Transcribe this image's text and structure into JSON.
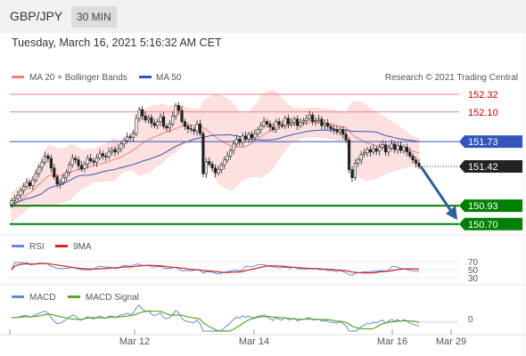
{
  "header": {
    "pair": "GBP/JPY",
    "timeframe": "30 MIN"
  },
  "timestamp": "Tuesday, March 16, 2021 5:16:32 AM CET",
  "legend": {
    "ma20": "MA 20 + Bollinger Bands",
    "ma50": "MA 50",
    "credit": "Research © 2021 Trading Central"
  },
  "rsi_legend": {
    "rsi": "RSI",
    "ma9": "9MA"
  },
  "macd_legend": {
    "macd": "MACD",
    "signal": "MACD Signal"
  },
  "colors": {
    "resistance": "#f08080",
    "resistance_text": "#cc0000",
    "support": "#008000",
    "ma50": "#3355bb",
    "bands": "#fde0e0",
    "arrow": "#2e6196",
    "rsi": "#6688dd",
    "rsi_ma": "#dd2222",
    "macd": "#6688dd",
    "macd_signal": "#55aa22"
  },
  "chart_data": {
    "type": "candlestick",
    "ylim": [
      150.62,
      152.42
    ],
    "x_ticks": [
      "Mar 12",
      "Mar 14",
      "Mar 16",
      "Mar 29"
    ],
    "levels": [
      {
        "value": 152.32,
        "label": "152.32",
        "kind": "resistance"
      },
      {
        "value": 152.1,
        "label": "152.10",
        "kind": "resistance"
      },
      {
        "value": 151.73,
        "label": "151.73",
        "kind": "pivot"
      },
      {
        "value": 151.42,
        "label": "151.42",
        "kind": "last"
      },
      {
        "value": 150.93,
        "label": "150.93",
        "kind": "support"
      },
      {
        "value": 150.7,
        "label": "150.70",
        "kind": "support"
      }
    ],
    "close": [
      150.99,
      151.02,
      151.06,
      151.12,
      151.17,
      151.22,
      151.18,
      151.25,
      151.33,
      151.41,
      151.47,
      151.55,
      151.52,
      151.4,
      151.29,
      151.2,
      151.22,
      151.28,
      151.35,
      151.44,
      151.52,
      151.5,
      151.43,
      151.39,
      151.45,
      151.52,
      151.49,
      151.47,
      151.53,
      151.58,
      151.55,
      151.54,
      151.6,
      151.63,
      151.6,
      151.64,
      151.7,
      151.74,
      151.79,
      151.78,
      151.83,
      152.02,
      152.13,
      152.05,
      152.0,
      152.03,
      151.96,
      151.93,
      151.98,
      152.04,
      151.92,
      151.9,
      151.95,
      152.05,
      152.18,
      152.12,
      151.98,
      151.92,
      151.89,
      151.88,
      151.86,
      151.95,
      151.83,
      151.33,
      151.48,
      151.45,
      151.4,
      151.34,
      151.38,
      151.44,
      151.5,
      151.55,
      151.62,
      151.7,
      151.76,
      151.72,
      151.8,
      151.76,
      151.82,
      151.78,
      151.83,
      151.88,
      151.93,
      151.98,
      151.95,
      151.91,
      151.88,
      151.98,
      151.94,
      151.93,
      152.02,
      151.95,
      151.97,
      152.01,
      151.93,
      151.97,
      151.99,
      152.02,
      152.06,
      151.98,
      151.99,
      152.01,
      151.93,
      151.96,
      151.92,
      151.89,
      151.88,
      151.85,
      151.88,
      151.82,
      151.75,
      151.38,
      151.28,
      151.46,
      151.5,
      151.57,
      151.59,
      151.63,
      151.6,
      151.64,
      151.61,
      151.66,
      151.69,
      151.6,
      151.65,
      151.7,
      151.63,
      151.68,
      151.62,
      151.66,
      151.6,
      151.55,
      151.5,
      151.46,
      151.42
    ],
    "ma20": [
      150.9,
      150.94,
      150.97,
      151.0,
      151.03,
      151.07,
      151.09,
      151.12,
      151.16,
      151.2,
      151.23,
      151.27,
      151.3,
      151.31,
      151.31,
      151.3,
      151.3,
      151.31,
      151.32,
      151.34,
      151.36,
      151.37,
      151.38,
      151.38,
      151.39,
      151.41,
      151.42,
      151.43,
      151.44,
      151.45,
      151.46,
      151.47,
      151.48,
      151.5,
      151.51,
      151.52,
      151.54,
      151.56,
      151.58,
      151.6,
      151.62,
      151.65,
      151.68,
      151.71,
      151.73,
      151.75,
      151.77,
      151.79,
      151.8,
      151.82,
      151.84,
      151.85,
      151.86,
      151.88,
      151.89,
      151.91,
      151.92,
      151.93,
      151.93,
      151.93,
      151.93,
      151.94,
      151.93,
      151.9,
      151.88,
      151.85,
      151.82,
      151.79,
      151.76,
      151.74,
      151.72,
      151.7,
      151.68,
      151.67,
      151.66,
      151.66,
      151.66,
      151.67,
      151.69,
      151.71,
      151.74,
      151.76,
      151.79,
      151.82,
      151.84,
      151.86,
      151.88,
      151.9,
      151.91,
      151.92,
      151.93,
      151.93,
      151.94,
      151.94,
      151.95,
      151.95,
      151.96,
      151.96,
      151.97,
      151.97,
      151.97,
      151.97,
      151.96,
      151.96,
      151.95,
      151.95,
      151.94,
      151.93,
      151.92,
      151.91,
      151.9,
      151.86,
      151.82,
      151.79,
      151.77,
      151.75,
      151.73,
      151.71,
      151.7,
      151.69,
      151.68,
      151.68,
      151.68,
      151.68,
      151.67,
      151.67,
      151.66,
      151.66,
      151.65,
      151.64,
      151.63,
      151.62,
      151.61,
      151.6,
      151.59
    ]
  }
}
